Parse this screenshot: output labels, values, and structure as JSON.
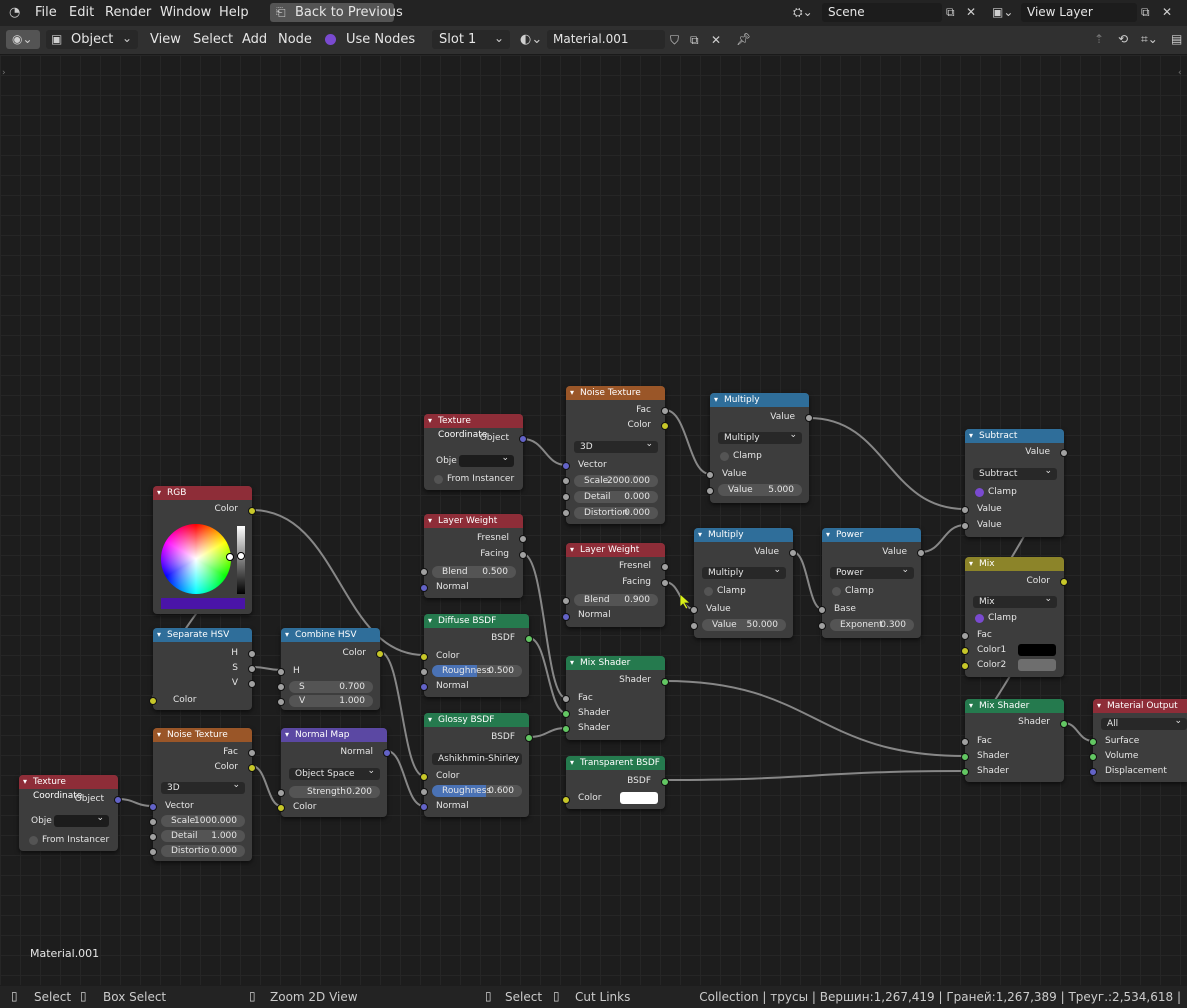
{
  "menubar": {
    "items": [
      "File",
      "Edit",
      "Render",
      "Window",
      "Help"
    ],
    "back_button": "Back to Previous",
    "scene_label": "Scene",
    "view_layer_label": "View Layer"
  },
  "header": {
    "mode": "Object",
    "view": "View",
    "select": "Select",
    "add": "Add",
    "node": "Node",
    "use_nodes": "Use Nodes",
    "slot": "Slot 1",
    "material": "Material.001"
  },
  "canvas": {
    "material_name": "Material.001"
  },
  "nodes": {
    "texcoord1": {
      "title": "Texture Coordinate",
      "object": "Object",
      "obj_field": "Obje",
      "from_instancer": "From Instancer"
    },
    "noise1": {
      "title": "Noise Texture",
      "fac": "Fac",
      "color": "Color",
      "dim": "3D",
      "vector": "Vector",
      "scale_lbl": "Scale",
      "scale": "2000.000",
      "detail_lbl": "Detail",
      "detail": "0.000",
      "distortion_lbl": "Distortion",
      "distortion": "0.000"
    },
    "multiply1": {
      "title": "Multiply",
      "value_out": "Value",
      "op": "Multiply",
      "clamp": "Clamp",
      "value_in": "Value",
      "value_lbl": "Value",
      "value": "5.000"
    },
    "subtract": {
      "title": "Subtract",
      "value_out": "Value",
      "op": "Subtract",
      "clamp": "Clamp",
      "value_in1": "Value",
      "value_in2": "Value"
    },
    "rgb": {
      "title": "RGB",
      "color": "Color",
      "swatch": "#4a14a8"
    },
    "layerweight1": {
      "title": "Layer Weight",
      "fresnel": "Fresnel",
      "facing": "Facing",
      "blend_lbl": "Blend",
      "blend": "0.500",
      "normal": "Normal"
    },
    "layerweight2": {
      "title": "Layer Weight",
      "fresnel": "Fresnel",
      "facing": "Facing",
      "blend_lbl": "Blend",
      "blend": "0.900",
      "normal": "Normal"
    },
    "multiply2": {
      "title": "Multiply",
      "value_out": "Value",
      "op": "Multiply",
      "clamp": "Clamp",
      "value_in": "Value",
      "value_lbl": "Value",
      "value": "50.000"
    },
    "power": {
      "title": "Power",
      "value_out": "Value",
      "op": "Power",
      "clamp": "Clamp",
      "base": "Base",
      "exp_lbl": "Exponent",
      "exp": "0.300"
    },
    "mix": {
      "title": "Mix",
      "color_out": "Color",
      "op": "Mix",
      "clamp": "Clamp",
      "fac": "Fac",
      "color1": "Color1",
      "color2": "Color2",
      "c1": "#000000",
      "c2": "#6e6e6e"
    },
    "sephsv": {
      "title": "Separate HSV",
      "h": "H",
      "s": "S",
      "v": "V",
      "color": "Color"
    },
    "combhsv": {
      "title": "Combine HSV",
      "color": "Color",
      "h": "H",
      "s_lbl": "S",
      "s": "0.700",
      "v_lbl": "V",
      "v": "1.000"
    },
    "diffuse": {
      "title": "Diffuse BSDF",
      "bsdf": "BSDF",
      "color": "Color",
      "rough_lbl": "Roughness",
      "rough": "0.500",
      "normal": "Normal"
    },
    "mixshader1": {
      "title": "Mix Shader",
      "shader_out": "Shader",
      "fac": "Fac",
      "shader1": "Shader",
      "shader2": "Shader"
    },
    "glossy": {
      "title": "Glossy BSDF",
      "bsdf": "BSDF",
      "dist": "Ashikhmin-Shirley",
      "color": "Color",
      "rough_lbl": "Roughness",
      "rough": "0.600",
      "normal": "Normal"
    },
    "transparent": {
      "title": "Transparent BSDF",
      "bsdf": "BSDF",
      "color": "Color",
      "swatch": "#ffffff"
    },
    "mixshader2": {
      "title": "Mix Shader",
      "shader_out": "Shader",
      "fac": "Fac",
      "shader1": "Shader",
      "shader2": "Shader"
    },
    "output": {
      "title": "Material Output",
      "target": "All",
      "surface": "Surface",
      "volume": "Volume",
      "displacement": "Displacement"
    },
    "noise2": {
      "title": "Noise Texture",
      "fac": "Fac",
      "color": "Color",
      "dim": "3D",
      "vector": "Vector",
      "scale_lbl": "Scale",
      "scale": "1000.000",
      "detail_lbl": "Detail",
      "detail": "1.000",
      "distortion_lbl": "Distortio",
      "distortion": "0.000"
    },
    "normalmap": {
      "title": "Normal Map",
      "normal": "Normal",
      "space": "Object Space",
      "strength_lbl": "Strength",
      "strength": "0.200",
      "color": "Color"
    },
    "texcoord2": {
      "title": "Texture Coordinate",
      "object": "Object",
      "obj_field": "Obje",
      "from_instancer": "From Instancer"
    }
  },
  "statusbar": {
    "select": "Select",
    "box_select": "Box Select",
    "zoom": "Zoom 2D View",
    "select2": "Select",
    "cut_links": "Cut Links",
    "stats": "Collection | трусы | Вершин:1,267,419 | Граней:1,267,389 | Треуг.:2,534,618 |"
  }
}
